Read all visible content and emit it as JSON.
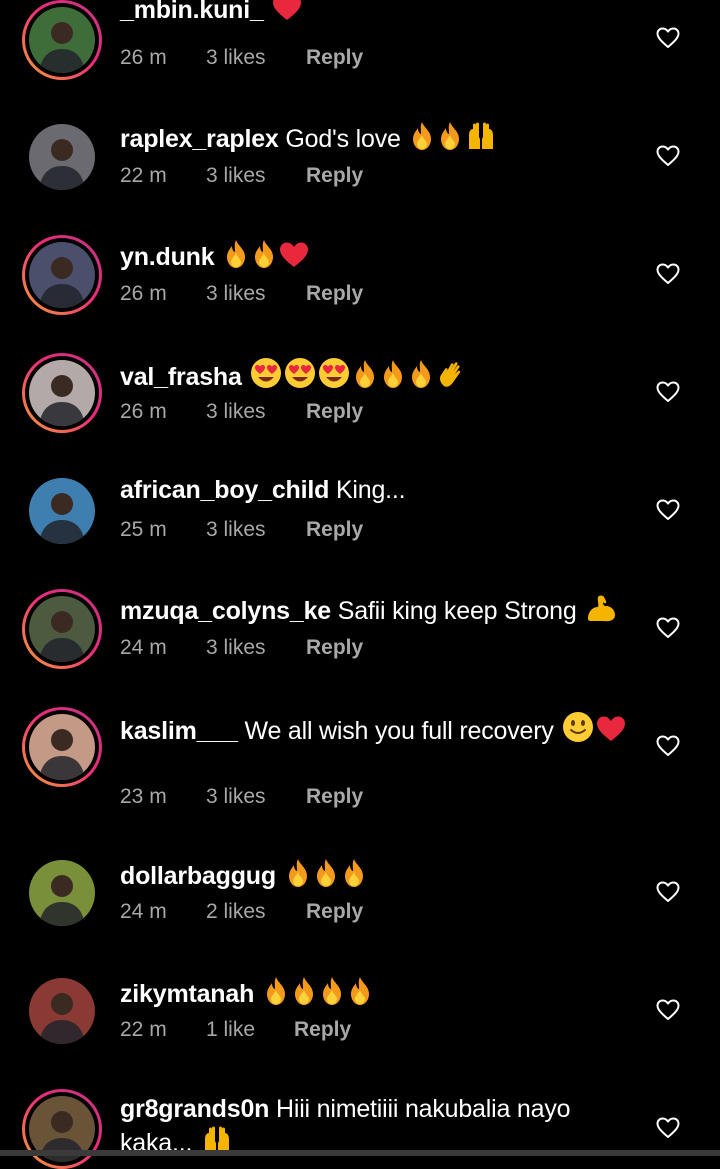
{
  "comments": [
    {
      "username": "_mbin.kuni_",
      "text": "",
      "emojis": [
        "heart"
      ],
      "time": "26 m",
      "likes": "3 likes",
      "reply": "Reply",
      "story_ring": true
    },
    {
      "username": "raplex_raplex",
      "text": "God's love",
      "emojis": [
        "fire",
        "fire",
        "raised-hands"
      ],
      "time": "22 m",
      "likes": "3 likes",
      "reply": "Reply",
      "story_ring": false
    },
    {
      "username": "yn.dunk",
      "text": "",
      "emojis": [
        "fire",
        "fire",
        "heart"
      ],
      "time": "26 m",
      "likes": "3 likes",
      "reply": "Reply",
      "story_ring": true
    },
    {
      "username": "val_frasha",
      "text": "",
      "emojis": [
        "heart-eyes",
        "heart-eyes",
        "heart-eyes",
        "fire",
        "fire",
        "fire",
        "waving-hand"
      ],
      "time": "26 m",
      "likes": "3 likes",
      "reply": "Reply",
      "story_ring": true
    },
    {
      "username": "african_boy_child",
      "text": "King...",
      "emojis": [],
      "time": "25 m",
      "likes": "3 likes",
      "reply": "Reply",
      "story_ring": false
    },
    {
      "username": "mzuqa_colyns_ke",
      "text": "Safii king keep Strong",
      "emojis": [
        "flexed-biceps"
      ],
      "time": "24 m",
      "likes": "3 likes",
      "reply": "Reply",
      "story_ring": true
    },
    {
      "username": "kaslim___",
      "text": "We all wish you full recovery",
      "emojis": [
        "slightly-smiling-face",
        "heart"
      ],
      "time": "23 m",
      "likes": "3 likes",
      "reply": "Reply",
      "story_ring": true
    },
    {
      "username": "dollarbaggug",
      "text": "",
      "emojis": [
        "fire",
        "fire",
        "fire"
      ],
      "time": "24 m",
      "likes": "2 likes",
      "reply": "Reply",
      "story_ring": false
    },
    {
      "username": "zikymtanah",
      "text": "",
      "emojis": [
        "fire",
        "fire",
        "fire",
        "fire"
      ],
      "time": "22 m",
      "likes": "1 like",
      "reply": "Reply",
      "story_ring": false
    },
    {
      "username": "gr8grands0n",
      "text": "Hiii nimetiiii nakubalia nayo kaka...",
      "emojis": [
        "raised-hands"
      ],
      "time": "",
      "likes": "",
      "reply": "",
      "story_ring": true
    }
  ],
  "icons": {
    "like": "heart-outline-icon"
  },
  "colors": {
    "background": "#000000",
    "text": "#ffffff",
    "meta": "#a8a8a8",
    "heart": "#e8283c",
    "fire": "#f39a1c",
    "ring_start": "#f7a234",
    "ring_end": "#c13584"
  }
}
